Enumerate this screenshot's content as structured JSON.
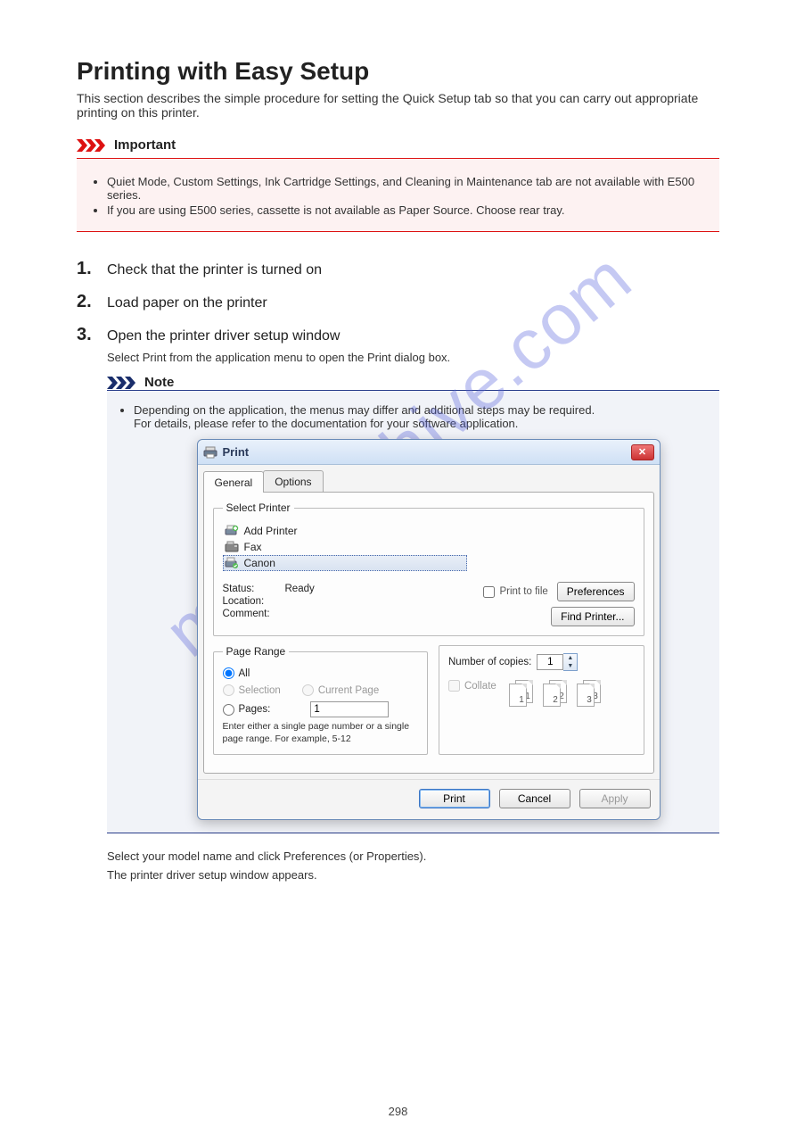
{
  "watermark": "manualshive.com",
  "page_title": "Printing with Easy Setup",
  "page_sub": "This section describes the simple procedure for setting the Quick Setup tab so that you can carry out appropriate printing on this printer.",
  "important": {
    "label": "Important",
    "items": [
      "Quiet Mode, Custom Settings, Ink Cartridge Settings, and Cleaning in Maintenance tab are not available with E500 series.",
      "If you are using E500 series, cassette is not available as Paper Source. Choose rear tray."
    ]
  },
  "steps": {
    "s1_num": "1.",
    "s1_text": "Check that the printer is turned on",
    "s2_num": "2.",
    "s2_text": "Load paper on the printer",
    "s3_num": "3.",
    "s3_text": "Open the printer driver setup window",
    "s3_detail": "Select Print from the application menu to open the Print dialog box."
  },
  "note": {
    "label": "Note",
    "list_item": "Depending on the application, the menus may differ and additional steps may be required.",
    "list_sub": "For details, please refer to the documentation for your software application."
  },
  "dialog": {
    "title": "Print",
    "tabs": {
      "general": "General",
      "options": "Options"
    },
    "select_printer": "Select Printer",
    "printers": {
      "add": "Add Printer",
      "fax": "Fax",
      "canon": "Canon"
    },
    "status_lbl": "Status:",
    "status_val": "Ready",
    "location_lbl": "Location:",
    "comment_lbl": "Comment:",
    "print_to_file": "Print to file",
    "preferences": "Preferences",
    "find_printer": "Find Printer...",
    "page_range": "Page Range",
    "radio_all": "All",
    "radio_selection": "Selection",
    "radio_current": "Current Page",
    "radio_pages": "Pages:",
    "pages_value": "1",
    "pages_hint": "Enter either a single page number or a single page range. For example, 5-12",
    "copies_lbl": "Number of copies:",
    "copies_val": "1",
    "collate": "Collate",
    "collate_nums": [
      "1",
      "2",
      "3"
    ],
    "btn_print": "Print",
    "btn_cancel": "Cancel",
    "btn_apply": "Apply"
  },
  "after_note": "Select your model name and click Preferences (or Properties).",
  "after_note2": "The printer driver setup window appears.",
  "page_number": "298"
}
